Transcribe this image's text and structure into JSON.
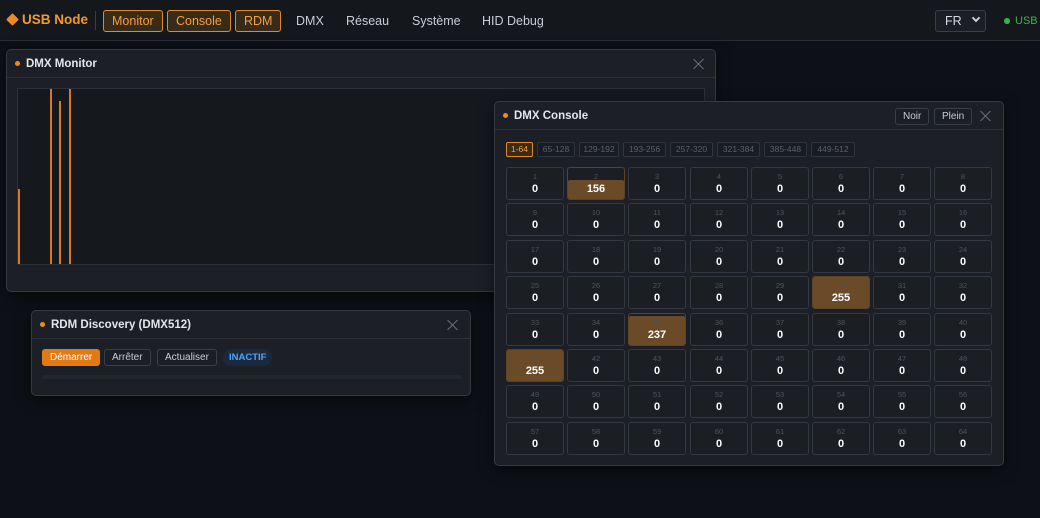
{
  "nav": {
    "brand": "USB Node",
    "buttons": [
      "Monitor",
      "Console",
      "RDM"
    ],
    "links": [
      "DMX",
      "Réseau",
      "Système",
      "HID Debug"
    ],
    "language": "FR",
    "usb_status": "USB",
    "accent_color": "#f08a1c",
    "usb_color": "#3fb24c"
  },
  "monitor": {
    "title": "DMX Monitor",
    "levels": [
      {
        "channel": 1,
        "value": 0.43
      },
      {
        "channel": 8,
        "value": 1.0
      },
      {
        "channel": 10,
        "value": 0.93
      },
      {
        "channel": 12,
        "value": 1.0
      }
    ]
  },
  "rdm": {
    "title": "RDM Discovery (DMX512)",
    "start_label": "Démarrer",
    "stop_label": "Arrêter",
    "refresh_label": "Actualiser",
    "status": "INACTIF"
  },
  "console": {
    "title": "DMX Console",
    "black_label": "Noir",
    "full_label": "Plein",
    "ranges": [
      "1-64",
      "65-128",
      "129-192",
      "193-256",
      "257-320",
      "321-384",
      "385-448",
      "449-512"
    ],
    "active_range": 0,
    "channels": [
      {
        "n": "1",
        "v": 0
      },
      {
        "n": "2",
        "v": 156
      },
      {
        "n": "3",
        "v": 0
      },
      {
        "n": "4",
        "v": 0
      },
      {
        "n": "5",
        "v": 0
      },
      {
        "n": "6",
        "v": 0
      },
      {
        "n": "7",
        "v": 0
      },
      {
        "n": "8",
        "v": 0
      },
      {
        "n": "9",
        "v": 0
      },
      {
        "n": "10",
        "v": 0
      },
      {
        "n": "11",
        "v": 0
      },
      {
        "n": "12",
        "v": 0
      },
      {
        "n": "13",
        "v": 0
      },
      {
        "n": "14",
        "v": 0
      },
      {
        "n": "15",
        "v": 0
      },
      {
        "n": "16",
        "v": 0
      },
      {
        "n": "17",
        "v": 0
      },
      {
        "n": "18",
        "v": 0
      },
      {
        "n": "19",
        "v": 0
      },
      {
        "n": "20",
        "v": 0
      },
      {
        "n": "21",
        "v": 0
      },
      {
        "n": "22",
        "v": 0
      },
      {
        "n": "23",
        "v": 0
      },
      {
        "n": "24",
        "v": 0
      },
      {
        "n": "25",
        "v": 0
      },
      {
        "n": "26",
        "v": 0
      },
      {
        "n": "27",
        "v": 0
      },
      {
        "n": "28",
        "v": 0
      },
      {
        "n": "29",
        "v": 0
      },
      {
        "n": "30",
        "v": 255
      },
      {
        "n": "31",
        "v": 0
      },
      {
        "n": "32",
        "v": 0
      },
      {
        "n": "33",
        "v": 0
      },
      {
        "n": "34",
        "v": 0
      },
      {
        "n": "35",
        "v": 237
      },
      {
        "n": "36",
        "v": 0
      },
      {
        "n": "37",
        "v": 0
      },
      {
        "n": "38",
        "v": 0
      },
      {
        "n": "39",
        "v": 0
      },
      {
        "n": "40",
        "v": 0
      },
      {
        "n": "41",
        "v": 255
      },
      {
        "n": "42",
        "v": 0
      },
      {
        "n": "43",
        "v": 0
      },
      {
        "n": "44",
        "v": 0
      },
      {
        "n": "45",
        "v": 0
      },
      {
        "n": "46",
        "v": 0
      },
      {
        "n": "47",
        "v": 0
      },
      {
        "n": "48",
        "v": 0
      },
      {
        "n": "49",
        "v": 0
      },
      {
        "n": "50",
        "v": 0
      },
      {
        "n": "51",
        "v": 0
      },
      {
        "n": "52",
        "v": 0
      },
      {
        "n": "53",
        "v": 0
      },
      {
        "n": "54",
        "v": 0
      },
      {
        "n": "55",
        "v": 0
      },
      {
        "n": "56",
        "v": 0
      },
      {
        "n": "57",
        "v": 0
      },
      {
        "n": "58",
        "v": 0
      },
      {
        "n": "59",
        "v": 0
      },
      {
        "n": "60",
        "v": 0
      },
      {
        "n": "61",
        "v": 0
      },
      {
        "n": "62",
        "v": 0
      },
      {
        "n": "63",
        "v": 0
      },
      {
        "n": "64",
        "v": 0
      }
    ]
  }
}
